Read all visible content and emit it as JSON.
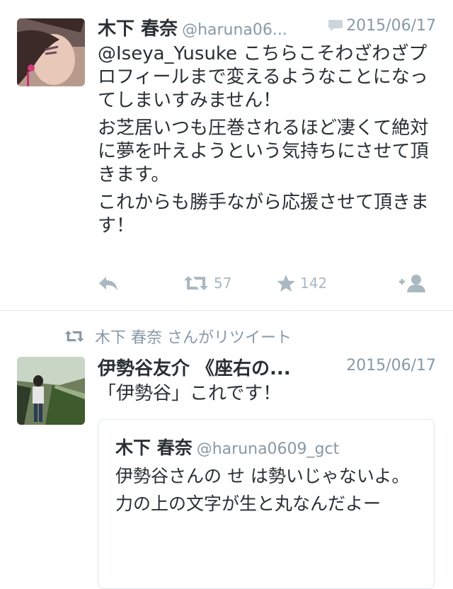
{
  "tweet1": {
    "name": "木下 春奈",
    "handle": "@haruna06...",
    "date": "2015/06/17",
    "paragraphs": [
      "@Iseya_Yusuke こちらこそわざわざプロフィールまで変えるようなことになってしまいすみません！",
      "お芝居いつも圧巻されるほど凄くて絶対に夢を叶えようという気持ちにさせて頂きます。",
      "これからも勝手ながら応援させて頂きます！"
    ],
    "actions": {
      "reply_icon": "reply-icon",
      "retweet_icon": "retweet-icon",
      "retweet_count": "57",
      "favorite_icon": "star-icon",
      "favorite_count": "142",
      "follow_icon": "add-user-icon"
    },
    "colors": {
      "icon_gray": "#aab8c2",
      "meta_gray": "#8899a6"
    }
  },
  "retweet_context": {
    "icon": "retweet-icon",
    "text": "木下 春奈 さんがリツイート"
  },
  "tweet2": {
    "name": "伊勢谷友介 《座右の...",
    "date": "2015/06/17",
    "text": "「伊勢谷」これです！",
    "quote": {
      "name": "木下 春奈",
      "handle": "@haruna0609_gct",
      "paragraphs": [
        "伊勢谷さんの せ は勢いじゃないよ。",
        "力の上の文字が生と丸なんだよー"
      ]
    }
  }
}
